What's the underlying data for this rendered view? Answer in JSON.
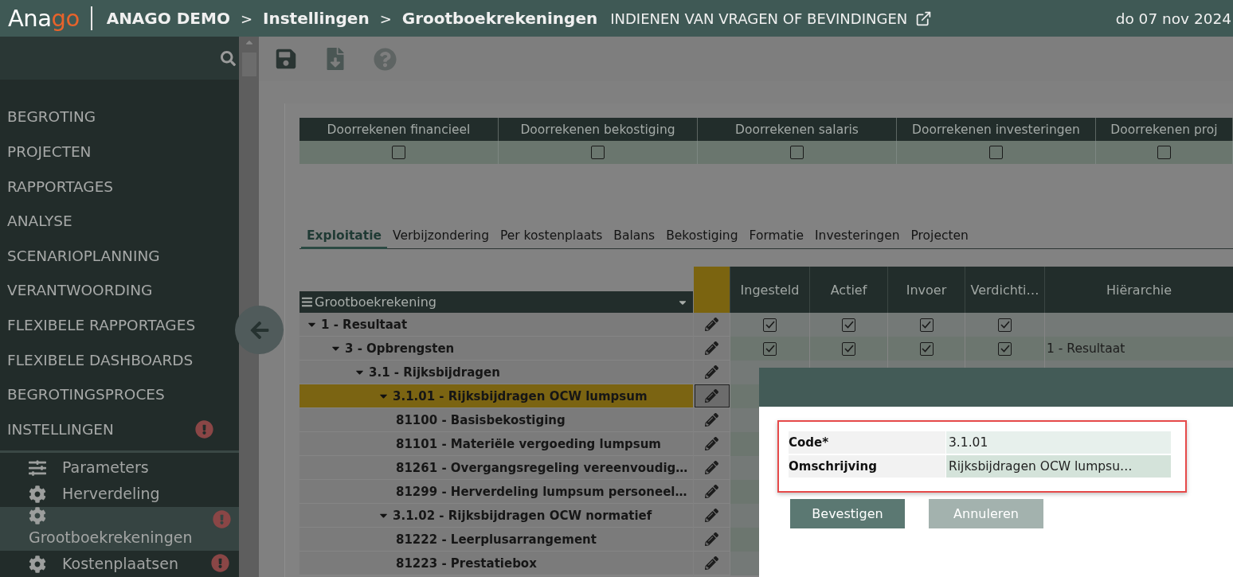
{
  "header": {
    "logo": [
      {
        "text": "Ana",
        "color": "#ffffff"
      },
      {
        "text": "go",
        "color": "#e8632b"
      }
    ],
    "breadcrumb": [
      "ANAGO DEMO",
      "Instellingen",
      "Grootboekrekeningen"
    ],
    "separator": ">",
    "feedback_link": "INDIENEN VAN VRAGEN OF BEVINDINGEN",
    "date": "do 07 nov 2024"
  },
  "sidebar": {
    "items": [
      {
        "label": "BEGROTING",
        "alert": false
      },
      {
        "label": "PROJECTEN",
        "alert": false
      },
      {
        "label": "RAPPORTAGES",
        "alert": false
      },
      {
        "label": "ANALYSE",
        "alert": false
      },
      {
        "label": "SCENARIOPLANNING",
        "alert": false
      },
      {
        "label": "VERANTWOORDING",
        "alert": false
      },
      {
        "label": "FLEXIBELE RAPPORTAGES",
        "alert": false
      },
      {
        "label": "FLEXIBELE DASHBOARDS",
        "alert": false
      },
      {
        "label": "BEGROTINGSPROCES",
        "alert": false
      },
      {
        "label": "INSTELLINGEN",
        "alert": true
      }
    ],
    "subitems": [
      {
        "label": "Parameters",
        "kind": "sliders",
        "selected": false,
        "alert": false
      },
      {
        "label": "Herverdeling",
        "kind": "gear",
        "selected": false,
        "alert": false
      },
      {
        "label": "Grootboekrekeningen",
        "kind": "gear",
        "selected": true,
        "alert": true
      },
      {
        "label": "Kostenplaatsen",
        "kind": "gear",
        "selected": false,
        "alert": true
      }
    ]
  },
  "settings_table": {
    "columns": [
      {
        "label": "Doorrekenen financieel",
        "checked": false
      },
      {
        "label": "Doorrekenen bekostiging",
        "checked": false
      },
      {
        "label": "Doorrekenen salaris",
        "checked": false
      },
      {
        "label": "Doorrekenen investeringen",
        "checked": false
      },
      {
        "label": "Doorrekenen proj",
        "checked": false
      }
    ]
  },
  "tabs": [
    {
      "label": "Exploitatie",
      "selected": true
    },
    {
      "label": "Verbijzondering",
      "selected": false
    },
    {
      "label": "Per kostenplaats",
      "selected": false
    },
    {
      "label": "Balans",
      "selected": false
    },
    {
      "label": "Bekostiging",
      "selected": false
    },
    {
      "label": "Formatie",
      "selected": false
    },
    {
      "label": "Investeringen",
      "selected": false
    },
    {
      "label": "Projecten",
      "selected": false
    }
  ],
  "grid": {
    "tree_column": "Grootboekrekening",
    "flag_columns": [
      "Ingesteld",
      "Actief",
      "Invoer",
      "Verdichti…"
    ],
    "hierarchy_column": "Hiërarchie",
    "rows": [
      {
        "label": "1 - Resultaat",
        "expanded": true,
        "selected": false,
        "flags": [
          true,
          true,
          true,
          true
        ],
        "children": [
          {
            "label": "3 - Opbrengsten",
            "expanded": true,
            "selected": false,
            "flags": [
              true,
              true,
              true,
              true
            ],
            "hierarchy": "1 - Resultaat",
            "children": [
              {
                "label": "3.1 - Rijksbijdragen",
                "expanded": true,
                "selected": false,
                "children": [
                  {
                    "label": "3.1.01 - Rijksbijdragen OCW lumpsum",
                    "expanded": true,
                    "selected": true,
                    "children": [
                      {
                        "label": "81100 - Basisbekostiging",
                        "selected": false
                      },
                      {
                        "label": "81101 - Materiële vergoeding lumpsum",
                        "selected": false
                      },
                      {
                        "label": "81261 - Overgangsregeling vereenvoudig…",
                        "selected": false
                      },
                      {
                        "label": "81299 - Herverdeling lumpsum personeel…",
                        "selected": false
                      }
                    ]
                  },
                  {
                    "label": "3.1.02 - Rijksbijdragen OCW normatief",
                    "expanded": true,
                    "selected": false,
                    "children": [
                      {
                        "label": "81222 - Leerplusarrangement",
                        "selected": false
                      },
                      {
                        "label": "81223 - Prestatiebox",
                        "selected": false
                      }
                    ]
                  }
                ]
              }
            ]
          }
        ]
      }
    ]
  },
  "dialog": {
    "fields": [
      {
        "label": "Code*",
        "value": "3.1.01"
      },
      {
        "label": "Omschrijving",
        "value": "Rijksbijdragen OCW lumpsu…"
      }
    ],
    "buttons": [
      {
        "label": "Bevestigen",
        "kind": "primary"
      },
      {
        "label": "Annuleren",
        "kind": "secondary"
      }
    ]
  }
}
